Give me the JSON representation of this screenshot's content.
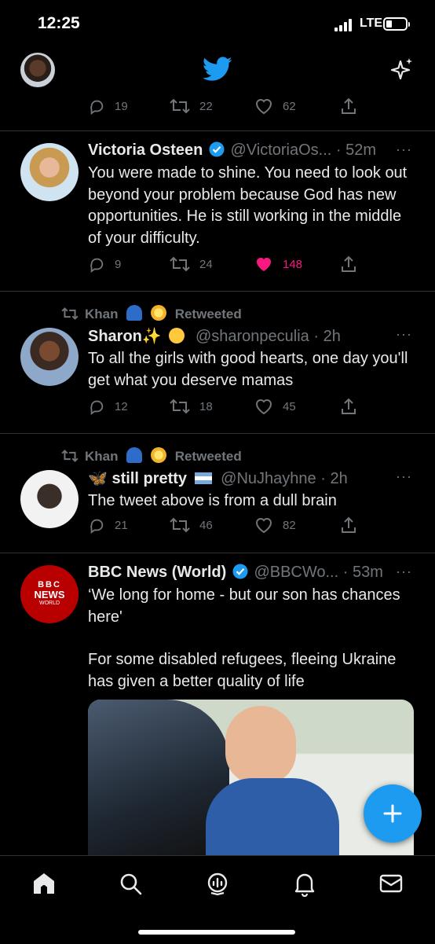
{
  "status": {
    "time": "12:25",
    "network": "LTE"
  },
  "header_icons": [
    "avatar",
    "twitter-bird-icon",
    "sparkle-icon"
  ],
  "tweets": [
    {
      "replies": "19",
      "retweets": "22",
      "likes": "62"
    },
    {
      "name": "Victoria Osteen",
      "handle": "@VictoriaOs...",
      "sep": "·",
      "time": "52m",
      "text": "You were made to shine. You need to look out beyond your problem because God has new opportunities. He is still working in the middle of your difficulty.",
      "replies": "9",
      "retweets": "24",
      "likes": "148",
      "liked": true
    },
    {
      "retweeted_by": "Khan",
      "retweeted_label": "Retweeted",
      "name": "Sharon",
      "handle": "@sharonpeculia",
      "sep": "·",
      "time": "2h",
      "text": "To all the girls with good hearts, one day you'll get what you deserve mamas",
      "replies": "12",
      "retweets": "18",
      "likes": "45"
    },
    {
      "retweeted_by": "Khan",
      "retweeted_label": "Retweeted",
      "name": "still pretty",
      "handle": "@NuJhayhne",
      "sep": "·",
      "time": "2h",
      "text": "The tweet above is from a dull brain",
      "replies": "21",
      "retweets": "46",
      "likes": "82"
    },
    {
      "name": "BBC News (World)",
      "handle": "@BBCWo...",
      "sep": "·",
      "time": "53m",
      "text_line1": "‘We long for home - but our son has chances here'",
      "text_line2": "For some disabled refugees, fleeing Ukraine has given a better quality of life",
      "avatar_text": [
        "BBC",
        "NEWS",
        "WORLD"
      ]
    }
  ],
  "more": "···",
  "colors": {
    "accent": "#1d9bf0",
    "like": "#f91880",
    "muted": "#71767b",
    "background": "#000000"
  },
  "tabs": [
    "home-icon",
    "search-icon",
    "spaces-icon",
    "notifications-icon",
    "messages-icon"
  ]
}
